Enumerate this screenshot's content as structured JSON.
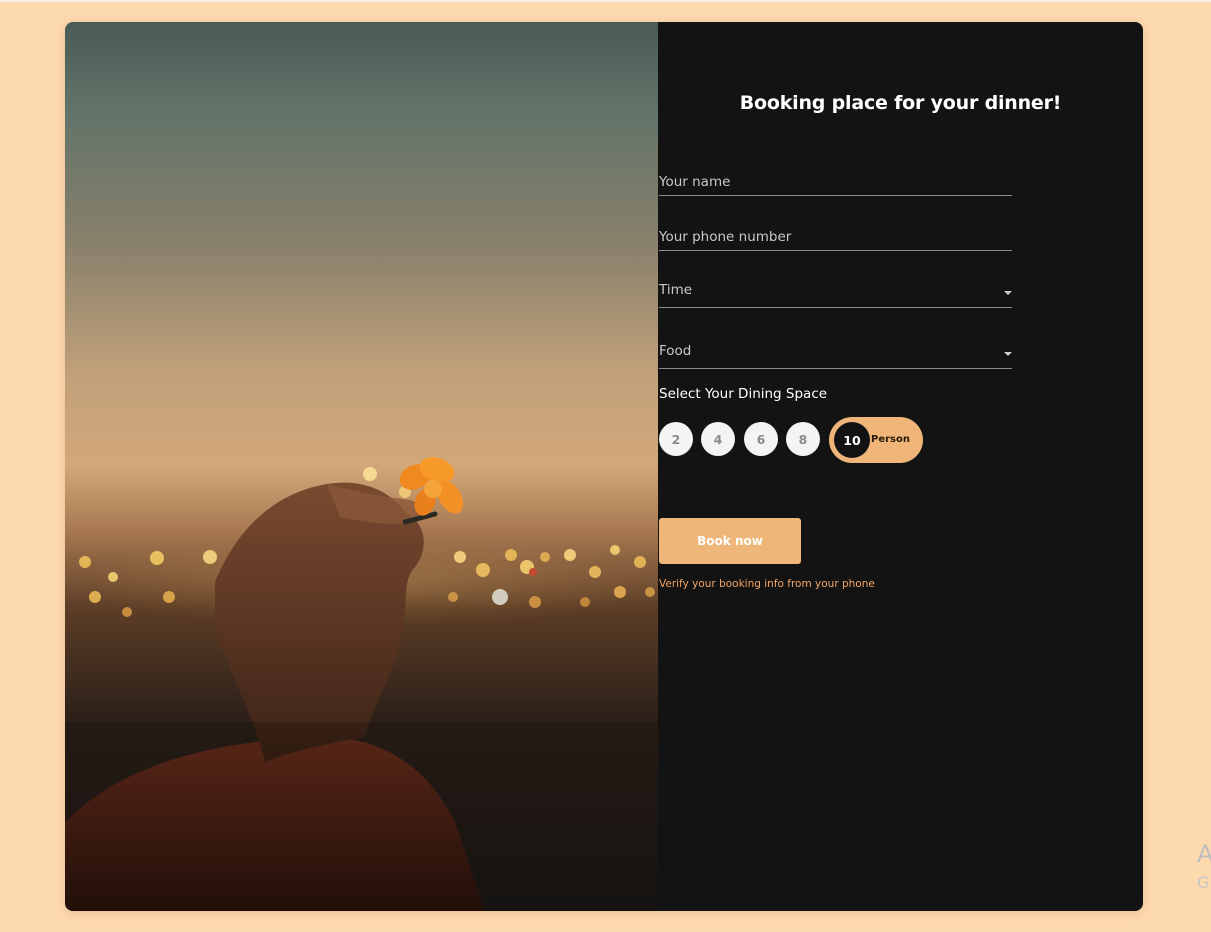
{
  "form": {
    "title": "Booking place for your dinner!",
    "name_placeholder": "Your name",
    "phone_placeholder": "Your phone number",
    "time_label": "Time",
    "food_label": "Food",
    "dining_space_label": "Select Your Dining Space",
    "space_options": [
      "2",
      "4",
      "6",
      "8"
    ],
    "selected_option": "10",
    "selected_suffix": "Person",
    "book_button": "Book now",
    "verify_text": "Verify your booking info from your phone"
  },
  "edge_text": {
    "line1": "A",
    "line2": "G"
  },
  "colors": {
    "page_background": "#fdd9ae",
    "panel_background": "#131313",
    "accent": "#efb679",
    "verify_text": "#f1a566"
  },
  "icons": {
    "time_dropdown": "caret-down-icon",
    "food_dropdown": "caret-down-icon"
  }
}
